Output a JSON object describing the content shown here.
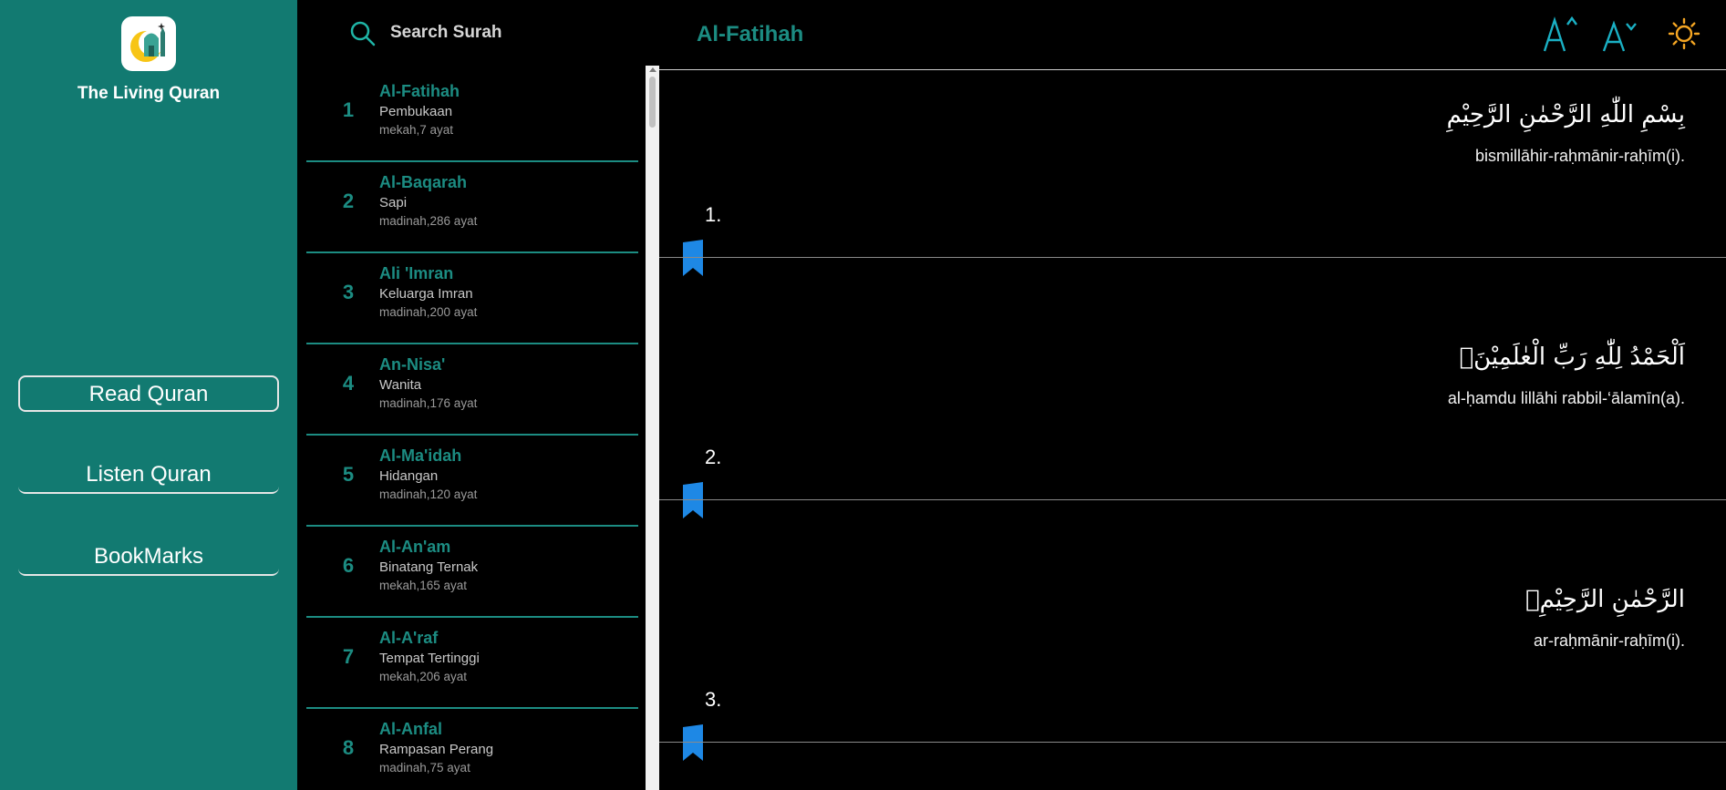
{
  "app": {
    "title": "The Living Quran",
    "accent_color": "#127a71",
    "text_accent_color": "#1c8c82",
    "logo_icon": "moon-mosque-icon"
  },
  "nav": {
    "items": [
      {
        "label": "Read Quran",
        "active": true
      },
      {
        "label": "Listen Quran",
        "active": false
      },
      {
        "label": "BookMarks",
        "active": false
      }
    ]
  },
  "search": {
    "placeholder": "Search Surah",
    "value": "",
    "icon": "search-icon"
  },
  "surahs": [
    {
      "number": "1",
      "name": "Al-Fatihah",
      "meaning": "Pembukaan",
      "info": "mekah,7 ayat"
    },
    {
      "number": "2",
      "name": "Al-Baqarah",
      "meaning": "Sapi",
      "info": "madinah,286 ayat"
    },
    {
      "number": "3",
      "name": "Ali 'Imran",
      "meaning": "Keluarga Imran",
      "info": "madinah,200 ayat"
    },
    {
      "number": "4",
      "name": "An-Nisa'",
      "meaning": "Wanita",
      "info": "madinah,176 ayat"
    },
    {
      "number": "5",
      "name": "Al-Ma'idah",
      "meaning": "Hidangan",
      "info": "madinah,120 ayat"
    },
    {
      "number": "6",
      "name": "Al-An'am",
      "meaning": "Binatang Ternak",
      "info": "mekah,165 ayat"
    },
    {
      "number": "7",
      "name": "Al-A'raf",
      "meaning": "Tempat Tertinggi",
      "info": "mekah,206 ayat"
    },
    {
      "number": "8",
      "name": "Al-Anfal",
      "meaning": "Rampasan Perang",
      "info": "madinah,75 ayat"
    }
  ],
  "reader": {
    "title": "Al-Fatihah",
    "tools": {
      "increase_font_icon": "font-increase-icon",
      "decrease_font_icon": "font-decrease-icon",
      "theme_icon": "sun-icon",
      "theme_color": "#f5a623",
      "tool_color": "#1ab0c4"
    },
    "bookmark_color": "#1e88e5",
    "verses": [
      {
        "arabic": "بِسْمِ اللّٰهِ الرَّحْمٰنِ الرَّحِيْمِ",
        "latin": "bismillāhir-raḥmānir-raḥīm(i).",
        "number": "1."
      },
      {
        "arabic": "اَلْحَمْدُ لِلّٰهِ رَبِّ الْعٰلَمِيْنَۙ",
        "latin": "al-ḥamdu lillāhi rabbil-‘ālamīn(a).",
        "number": "2."
      },
      {
        "arabic": "الرَّحْمٰنِ الرَّحِيْمِۙ",
        "latin": "ar-raḥmānir-raḥīm(i).",
        "number": "3."
      }
    ]
  }
}
